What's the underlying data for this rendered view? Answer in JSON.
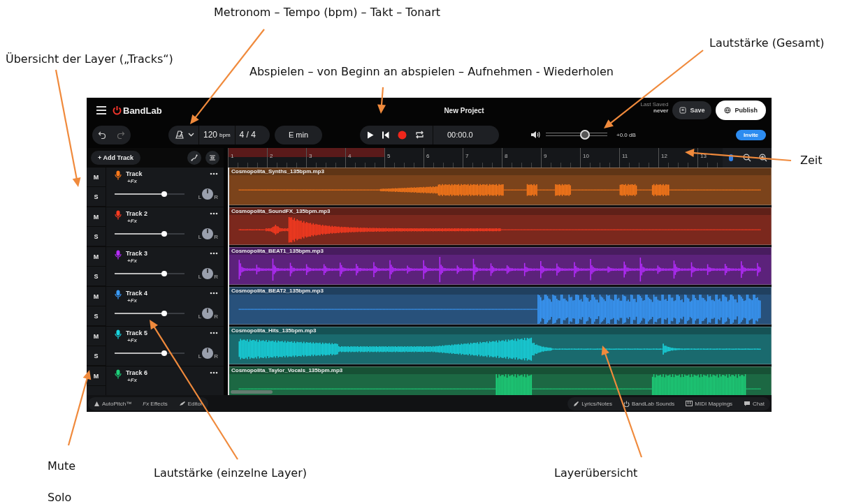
{
  "annotations": [
    {
      "text": "Metronom – Tempo (bpm) – Takt – Tonart",
      "arrow": true
    },
    {
      "text": "Übersicht der Layer („Tracks“)",
      "arrow": true
    },
    {
      "text": "Abspielen – von Beginn an abspielen – Aufnehmen - Wiederholen",
      "arrow": true
    },
    {
      "text": "Lautstärke (Gesamt)",
      "arrow": true
    },
    {
      "text": "Zeit",
      "arrow": true
    },
    {
      "text": "Mute",
      "arrow": true
    },
    {
      "text": "Solo",
      "arrow": false
    },
    {
      "text": "Lautstärke (einzelne Layer)",
      "arrow": true
    },
    {
      "text": "Layerübersicht",
      "arrow": true
    }
  ],
  "app": {
    "logo": "BandLab",
    "title": "New Project",
    "last_saved_label": "Last Saved",
    "last_saved_value": "never",
    "save": "Save",
    "publish": "Publish",
    "invite": "Invite",
    "tempo": "120",
    "tempo_unit": "bpm",
    "time_signature": "4 / 4",
    "key": "E min",
    "time": "00:00.0",
    "master_volume": {
      "level": 0.64,
      "reading": "+0.0 dB"
    },
    "add_track": "+ Add Track",
    "ruler": [
      "1",
      "2",
      "3",
      "4",
      "5",
      "6",
      "7",
      "8",
      "9",
      "10",
      "11",
      "12",
      "13"
    ],
    "tracks": [
      {
        "name": "Track",
        "fx": "+Fx",
        "mute": "M",
        "solo": "S",
        "level": 0.71,
        "pan_left": "L",
        "pan_right": "R",
        "color": "#ff7a1a",
        "clip": "Cosmopolita_Synths_135bpm.mp3"
      },
      {
        "name": "Track 2",
        "fx": "+Fx",
        "mute": "M",
        "solo": "S",
        "level": 0.71,
        "pan_left": "L",
        "pan_right": "R",
        "color": "#ff3b20",
        "clip": "Cosmopolita_SoundFX_135bpm.mp3"
      },
      {
        "name": "Track 3",
        "fx": "+Fx",
        "mute": "M",
        "solo": "S",
        "level": 0.71,
        "pan_left": "L",
        "pan_right": "R",
        "color": "#b62cff",
        "clip": "Cosmopolita_BEAT1_135bpm.mp3"
      },
      {
        "name": "Track 4",
        "fx": "+Fx",
        "mute": "M",
        "solo": "S",
        "level": 0.71,
        "pan_left": "L",
        "pan_right": "R",
        "color": "#3a9cff",
        "clip": "Cosmopolita_BEAT2_135bpm.mp3"
      },
      {
        "name": "Track 5",
        "fx": "+Fx",
        "mute": "M",
        "solo": "S",
        "level": 0.71,
        "pan_left": "L",
        "pan_right": "R",
        "color": "#18d6e0",
        "clip": "Cosmopolita_Hits_135bpm.mp3"
      },
      {
        "name": "Track 6",
        "fx": "+Fx",
        "mute": "M",
        "color": "#1dd27a",
        "clip": "Cosmopolita_Taylor_Vocals_135bpm.mp3"
      }
    ],
    "bottom_left": [
      {
        "kind": "autopitch",
        "label": "AutoPitch™"
      },
      {
        "kind": "effects",
        "label": "*Fx* Effects"
      },
      {
        "kind": "editor",
        "label": "Editor"
      }
    ],
    "bottom_right": [
      {
        "kind": "lyrics",
        "label": "Lyrics/Notes"
      },
      {
        "kind": "sounds",
        "label": "BandLab Sounds"
      },
      {
        "kind": "midi",
        "label": "MIDI Mappings"
      },
      {
        "kind": "chat",
        "label": "Chat"
      }
    ]
  }
}
